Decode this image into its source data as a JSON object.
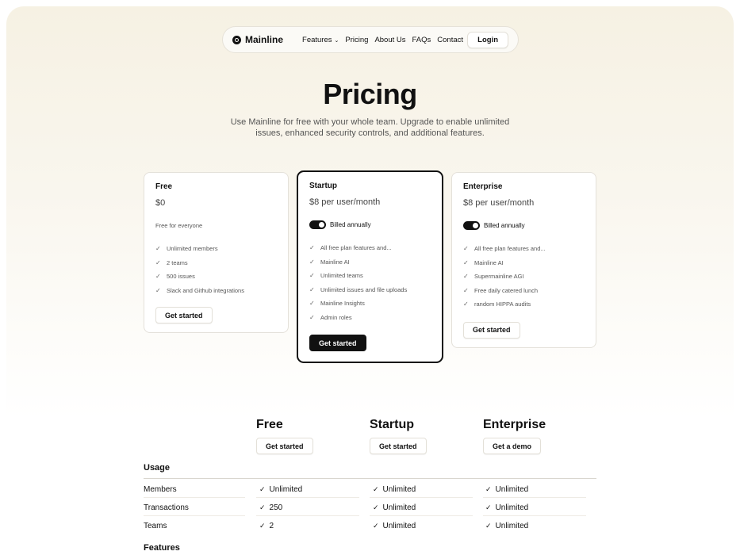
{
  "nav": {
    "brand": "Mainline",
    "links": [
      "Features",
      "Pricing",
      "About Us",
      "FAQs",
      "Contact"
    ],
    "login": "Login"
  },
  "hero": {
    "title": "Pricing",
    "subtitle": "Use Mainline for free with your whole team. Upgrade to enable unlimited issues, enhanced security controls, and additional features."
  },
  "plans": [
    {
      "name": "Free",
      "price": "$0",
      "note": "Free for everyone",
      "features": [
        "Unlimited members",
        "2 teams",
        "500 issues",
        "Slack and Github integrations"
      ],
      "cta": "Get started"
    },
    {
      "name": "Startup",
      "price": "$8 per user/month",
      "toggle_label": "Billed annually",
      "features": [
        "All free plan features and...",
        "Mainline AI",
        "Unlimited teams",
        "Unlimited issues and file uploads",
        "Mainline Insights",
        "Admin roles"
      ],
      "cta": "Get started"
    },
    {
      "name": "Enterprise",
      "price": "$8 per user/month",
      "toggle_label": "Billed annually",
      "features": [
        "All free plan features and...",
        "Mainline AI",
        "Supermainline AGI",
        "Free daily catered lunch",
        "random HIPPA audits"
      ],
      "cta": "Get started"
    }
  ],
  "compare": {
    "columns": [
      {
        "name": "Free",
        "cta": "Get started"
      },
      {
        "name": "Startup",
        "cta": "Get started"
      },
      {
        "name": "Enterprise",
        "cta": "Get a demo"
      }
    ],
    "usage_title": "Usage",
    "rows": [
      {
        "label": "Members",
        "values": [
          "Unlimited",
          "Unlimited",
          "Unlimited"
        ]
      },
      {
        "label": "Transactions",
        "values": [
          "250",
          "Unlimited",
          "Unlimited"
        ]
      },
      {
        "label": "Teams",
        "values": [
          "2",
          "Unlimited",
          "Unlimited"
        ]
      }
    ],
    "features_title": "Features"
  },
  "icons": {
    "check": "check-icon",
    "chevron": "chevron-down-icon",
    "logo": "mainline-logo-icon"
  }
}
